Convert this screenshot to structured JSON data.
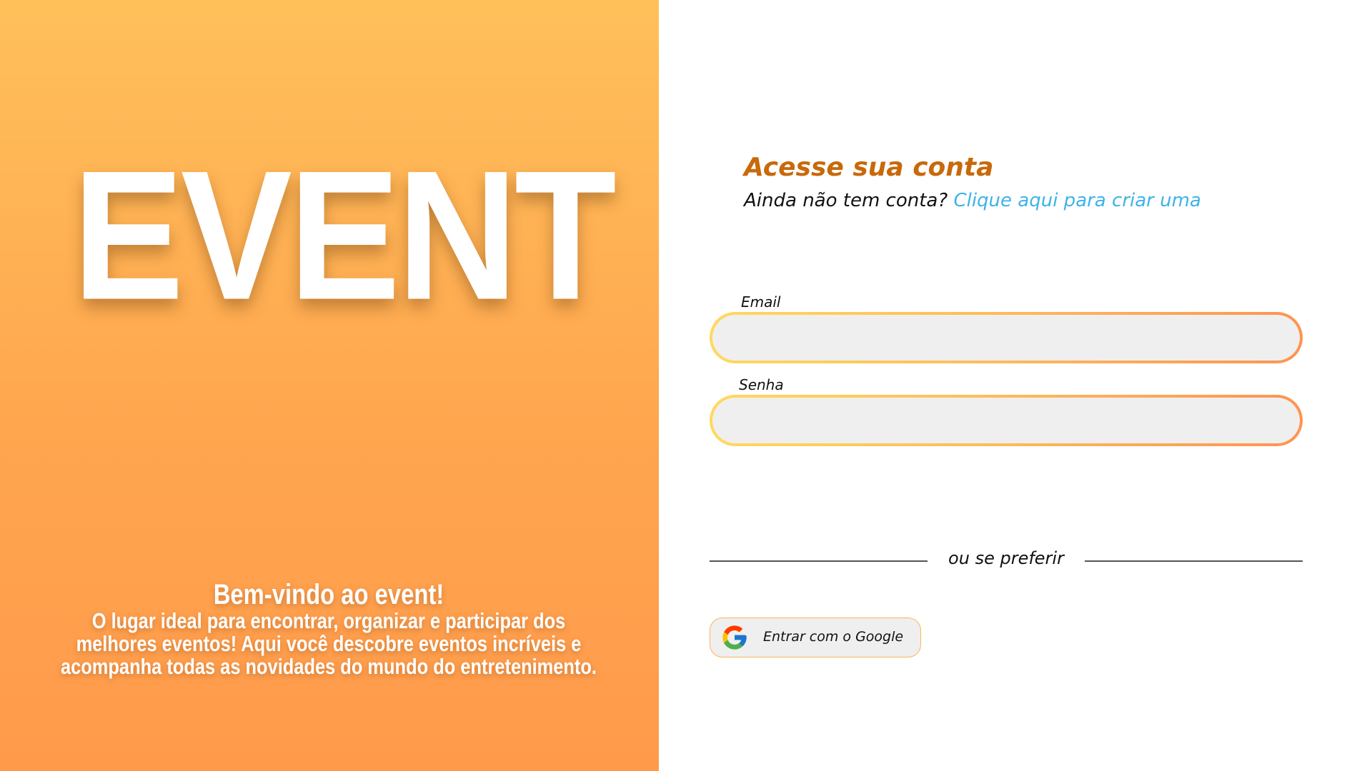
{
  "left": {
    "logo_text": "EVENT",
    "welcome_title": "Bem-vindo ao event!",
    "welcome_text": "O lugar ideal para encontrar, organizar e participar dos melhores eventos! Aqui você descobre eventos incríveis e acompanha todas as novidades do mundo do entretenimento."
  },
  "form": {
    "title": "Acesse sua conta",
    "signup_prompt": "Ainda não tem conta?",
    "signup_link": "Clique aqui para criar uma",
    "email_label": "Email",
    "email_value": "",
    "password_label": "Senha",
    "password_value": "",
    "divider_text": "ou se preferir",
    "google_button_label": "Entrar com o Google",
    "google_icon": "google-icon"
  },
  "colors": {
    "gradient_top": "#FFC05A",
    "gradient_bottom": "#FF9A4B",
    "title": "#C8690A",
    "link": "#3FB3E8",
    "input_bg": "#EFEFEF"
  }
}
